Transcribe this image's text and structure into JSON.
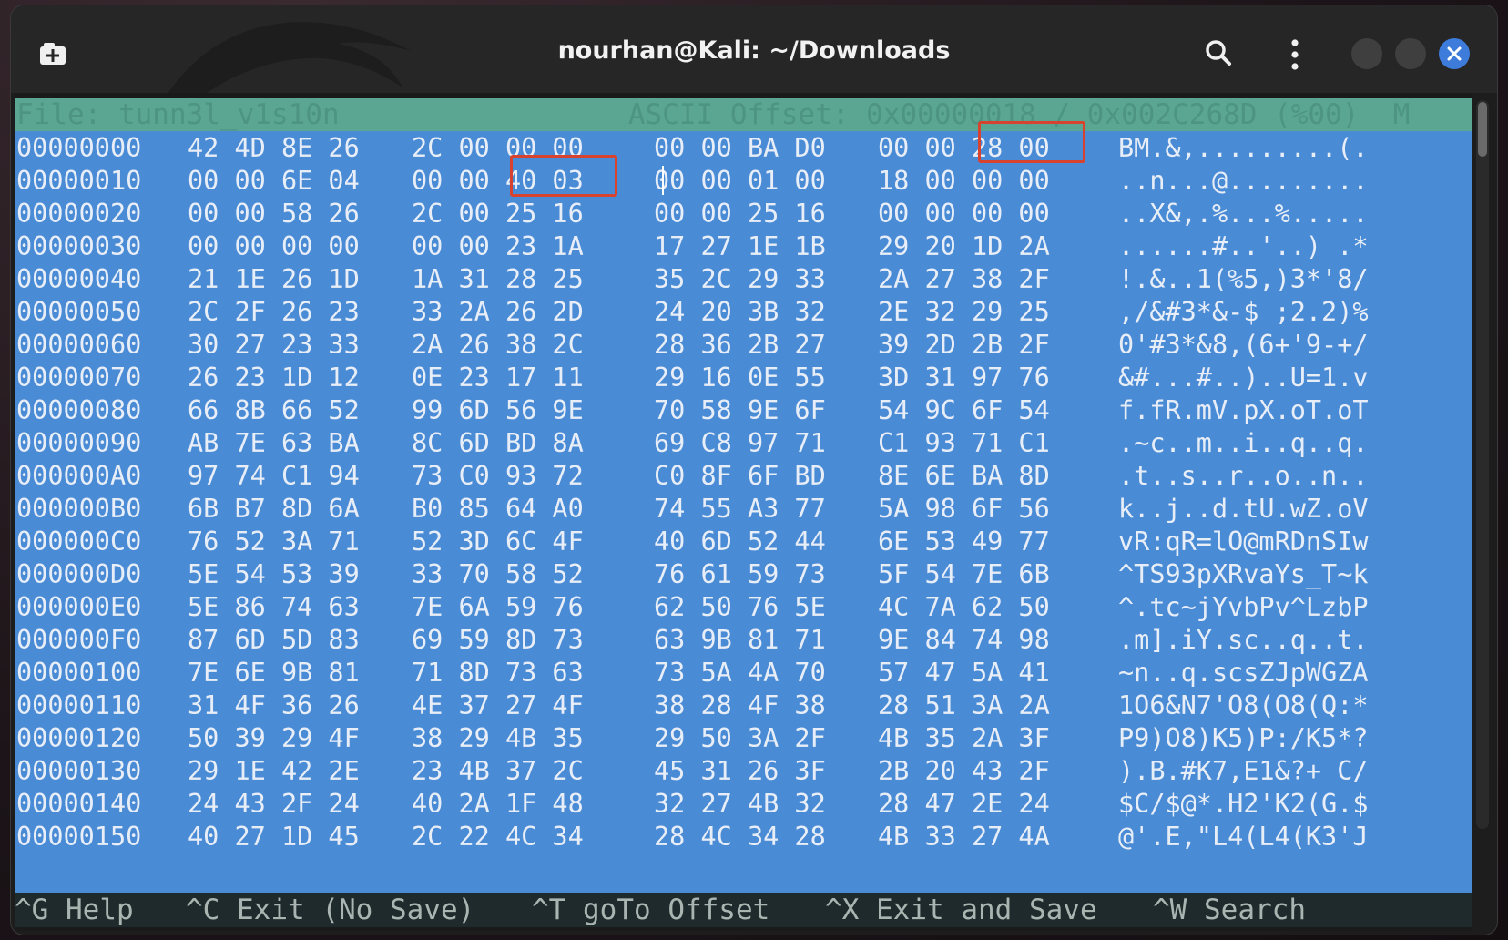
{
  "window": {
    "title": "nourhan@Kali: ~/Downloads",
    "close_color": "#3d7cdb"
  },
  "icons": {
    "new_tab": "new-tab-icon",
    "search": "search-icon",
    "menu": "kebab-menu-icon",
    "close": "close-icon"
  },
  "editor": {
    "header": "File: tunn3l_v1s10n                 ASCII Offset: 0x00000018 / 0x002C268D (%00)  M",
    "rows": [
      {
        "offset": "00000000",
        "g1": "42 4D 8E 26",
        "g2": "2C 00 00 00",
        "g3": "00 00 BA D0",
        "g4": "00 00 28 00",
        "ascii": "BM.&,.........(."
      },
      {
        "offset": "00000010",
        "g1": "00 00 6E 04",
        "g2": "00 00 40 03",
        "g3": "00 00 01 00",
        "g4": "18 00 00 00",
        "ascii": "..n...@........."
      },
      {
        "offset": "00000020",
        "g1": "00 00 58 26",
        "g2": "2C 00 25 16",
        "g3": "00 00 25 16",
        "g4": "00 00 00 00",
        "ascii": "..X&,.%...%....."
      },
      {
        "offset": "00000030",
        "g1": "00 00 00 00",
        "g2": "00 00 23 1A",
        "g3": "17 27 1E 1B",
        "g4": "29 20 1D 2A",
        "ascii": "......#..'..) .*"
      },
      {
        "offset": "00000040",
        "g1": "21 1E 26 1D",
        "g2": "1A 31 28 25",
        "g3": "35 2C 29 33",
        "g4": "2A 27 38 2F",
        "ascii": "!.&..1(%5,)3*'8/"
      },
      {
        "offset": "00000050",
        "g1": "2C 2F 26 23",
        "g2": "33 2A 26 2D",
        "g3": "24 20 3B 32",
        "g4": "2E 32 29 25",
        "ascii": ",/&#3*&-$ ;2.2)%"
      },
      {
        "offset": "00000060",
        "g1": "30 27 23 33",
        "g2": "2A 26 38 2C",
        "g3": "28 36 2B 27",
        "g4": "39 2D 2B 2F",
        "ascii": "0'#3*&8,(6+'9-+/"
      },
      {
        "offset": "00000070",
        "g1": "26 23 1D 12",
        "g2": "0E 23 17 11",
        "g3": "29 16 0E 55",
        "g4": "3D 31 97 76",
        "ascii": "&#...#..)..U=1.v"
      },
      {
        "offset": "00000080",
        "g1": "66 8B 66 52",
        "g2": "99 6D 56 9E",
        "g3": "70 58 9E 6F",
        "g4": "54 9C 6F 54",
        "ascii": "f.fR.mV.pX.oT.oT"
      },
      {
        "offset": "00000090",
        "g1": "AB 7E 63 BA",
        "g2": "8C 6D BD 8A",
        "g3": "69 C8 97 71",
        "g4": "C1 93 71 C1",
        "ascii": ".~c..m..i..q..q."
      },
      {
        "offset": "000000A0",
        "g1": "97 74 C1 94",
        "g2": "73 C0 93 72",
        "g3": "C0 8F 6F BD",
        "g4": "8E 6E BA 8D",
        "ascii": ".t..s..r..o..n.."
      },
      {
        "offset": "000000B0",
        "g1": "6B B7 8D 6A",
        "g2": "B0 85 64 A0",
        "g3": "74 55 A3 77",
        "g4": "5A 98 6F 56",
        "ascii": "k..j..d.tU.wZ.oV"
      },
      {
        "offset": "000000C0",
        "g1": "76 52 3A 71",
        "g2": "52 3D 6C 4F",
        "g3": "40 6D 52 44",
        "g4": "6E 53 49 77",
        "ascii": "vR:qR=lO@mRDnSIw"
      },
      {
        "offset": "000000D0",
        "g1": "5E 54 53 39",
        "g2": "33 70 58 52",
        "g3": "76 61 59 73",
        "g4": "5F 54 7E 6B",
        "ascii": "^TS93pXRvaYs_T~k"
      },
      {
        "offset": "000000E0",
        "g1": "5E 86 74 63",
        "g2": "7E 6A 59 76",
        "g3": "62 50 76 5E",
        "g4": "4C 7A 62 50",
        "ascii": "^.tc~jYvbPv^LzbP"
      },
      {
        "offset": "000000F0",
        "g1": "87 6D 5D 83",
        "g2": "69 59 8D 73",
        "g3": "63 9B 81 71",
        "g4": "9E 84 74 98",
        "ascii": ".m].iY.sc..q..t."
      },
      {
        "offset": "00000100",
        "g1": "7E 6E 9B 81",
        "g2": "71 8D 73 63",
        "g3": "73 5A 4A 70",
        "g4": "57 47 5A 41",
        "ascii": "~n..q.scsZJpWGZA"
      },
      {
        "offset": "00000110",
        "g1": "31 4F 36 26",
        "g2": "4E 37 27 4F",
        "g3": "38 28 4F 38",
        "g4": "28 51 3A 2A",
        "ascii": "1O6&N7'O8(O8(Q:*"
      },
      {
        "offset": "00000120",
        "g1": "50 39 29 4F",
        "g2": "38 29 4B 35",
        "g3": "29 50 3A 2F",
        "g4": "4B 35 2A 3F",
        "ascii": "P9)O8)K5)P:/K5*?"
      },
      {
        "offset": "00000130",
        "g1": "29 1E 42 2E",
        "g2": "23 4B 37 2C",
        "g3": "45 31 26 3F",
        "g4": "2B 20 43 2F",
        "ascii": ").B.#K7,E1&?+ C/"
      },
      {
        "offset": "00000140",
        "g1": "24 43 2F 24",
        "g2": "40 2A 1F 48",
        "g3": "32 27 4B 32",
        "g4": "28 47 2E 24",
        "ascii": "$C/$@*.H2'K2(G.$"
      },
      {
        "offset": "00000150",
        "g1": "40 27 1D 45",
        "g2": "2C 22 4C 34",
        "g3": "28 4C 34 28",
        "g4": "4B 33 27 4A",
        "ascii": "@'.E,\"L4(L4(K3'J"
      }
    ],
    "footer": [
      {
        "key": "^G",
        "label": "Help"
      },
      {
        "key": "^C",
        "label": "Exit (No Save)"
      },
      {
        "key": "^T",
        "label": "goTo Offset"
      },
      {
        "key": "^X",
        "label": "Exit and Save"
      },
      {
        "key": "^W",
        "label": "Search"
      }
    ]
  }
}
